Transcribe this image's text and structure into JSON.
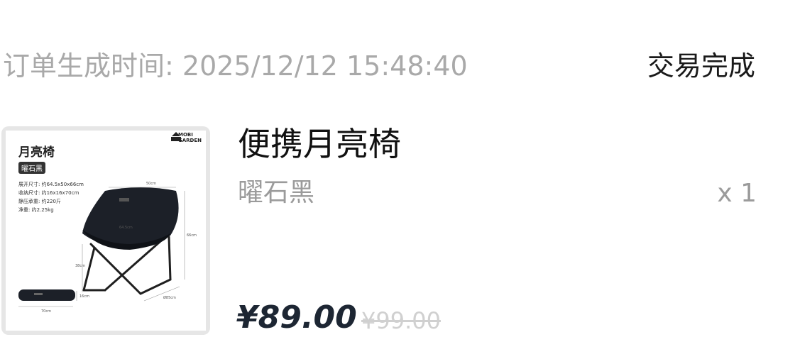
{
  "order": {
    "time_label": "订单生成时间:",
    "time_value": "2025/12/12 15:48:40",
    "status": "交易完成"
  },
  "product": {
    "name": "便携月亮椅",
    "variant": "曜石黑",
    "quantity": "x 1",
    "price": "¥89.00",
    "original_price": "¥99.00",
    "thumbnail": {
      "title": "月亮椅",
      "variant_tag": "曜石黑",
      "brand_line1": "MOBI",
      "brand_line2": "GARDEN",
      "specs": [
        "展开尺寸: 约64.5x50x66cm",
        "收纳尺寸: 约16x16x70cm",
        "静压承重: 约220斤",
        "净重: 约2.25kg"
      ],
      "dims": {
        "width": "50cm",
        "depth": "64.5cm",
        "height": "66cm",
        "seat": "38cm",
        "leg": "Ø85cm",
        "bag_len": "70cm",
        "bag_h": "16cm"
      }
    }
  }
}
